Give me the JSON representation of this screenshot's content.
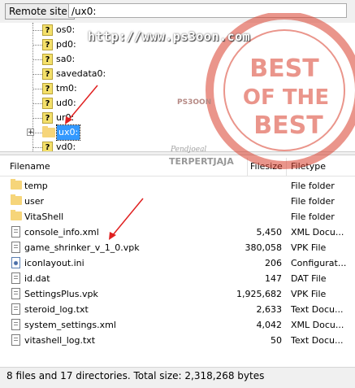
{
  "site": {
    "label": "Remote site:",
    "path": "/ux0:"
  },
  "tree": {
    "items": [
      {
        "label": "os0:"
      },
      {
        "label": "pd0:"
      },
      {
        "label": "sa0:"
      },
      {
        "label": "savedata0:"
      },
      {
        "label": "tm0:"
      },
      {
        "label": "ud0:"
      },
      {
        "label": "ur0:"
      },
      {
        "label": "ux0:"
      },
      {
        "label": "vd0:"
      }
    ],
    "expander_label": "+"
  },
  "columns": {
    "filename": "Filename",
    "filesize": "Filesize",
    "filetype": "Filetype"
  },
  "files": [
    {
      "name": "temp",
      "size": "",
      "type": "File folder",
      "icon": "folder-icon"
    },
    {
      "name": "user",
      "size": "",
      "type": "File folder",
      "icon": "folder-icon"
    },
    {
      "name": "VitaShell",
      "size": "",
      "type": "File folder",
      "icon": "folder-icon"
    },
    {
      "name": "console_info.xml",
      "size": "5,450",
      "type": "XML Docu...",
      "icon": "document-icon"
    },
    {
      "name": "game_shrinker_v_1_0.vpk",
      "size": "380,058",
      "type": "VPK File",
      "icon": "document-icon"
    },
    {
      "name": "iconlayout.ini",
      "size": "206",
      "type": "Configurat...",
      "icon": "settings-file-icon"
    },
    {
      "name": "id.dat",
      "size": "147",
      "type": "DAT File",
      "icon": "document-icon"
    },
    {
      "name": "SettingsPlus.vpk",
      "size": "1,925,682",
      "type": "VPK File",
      "icon": "document-icon"
    },
    {
      "name": "steroid_log.txt",
      "size": "2,633",
      "type": "Text Docu...",
      "icon": "document-icon"
    },
    {
      "name": "system_settings.xml",
      "size": "4,042",
      "type": "XML Docu...",
      "icon": "document-icon"
    },
    {
      "name": "vitashell_log.txt",
      "size": "50",
      "type": "Text Docu...",
      "icon": "document-icon"
    }
  ],
  "status": "8 files and 17 directories. Total size: 2,318,268 bytes",
  "watermark": "http://www.ps3oon.com",
  "badge": {
    "line1": "BEST",
    "line2": "OF THE",
    "line3": "BEST",
    "brand": "PS3OON",
    "tagline": "Pendjoeal",
    "tagline2": "TERPERTJAJA"
  },
  "colors": {
    "selection": "#3399ff",
    "folder": "#f6d57a",
    "badge": "#d9402e",
    "arrow": "#e02020"
  }
}
